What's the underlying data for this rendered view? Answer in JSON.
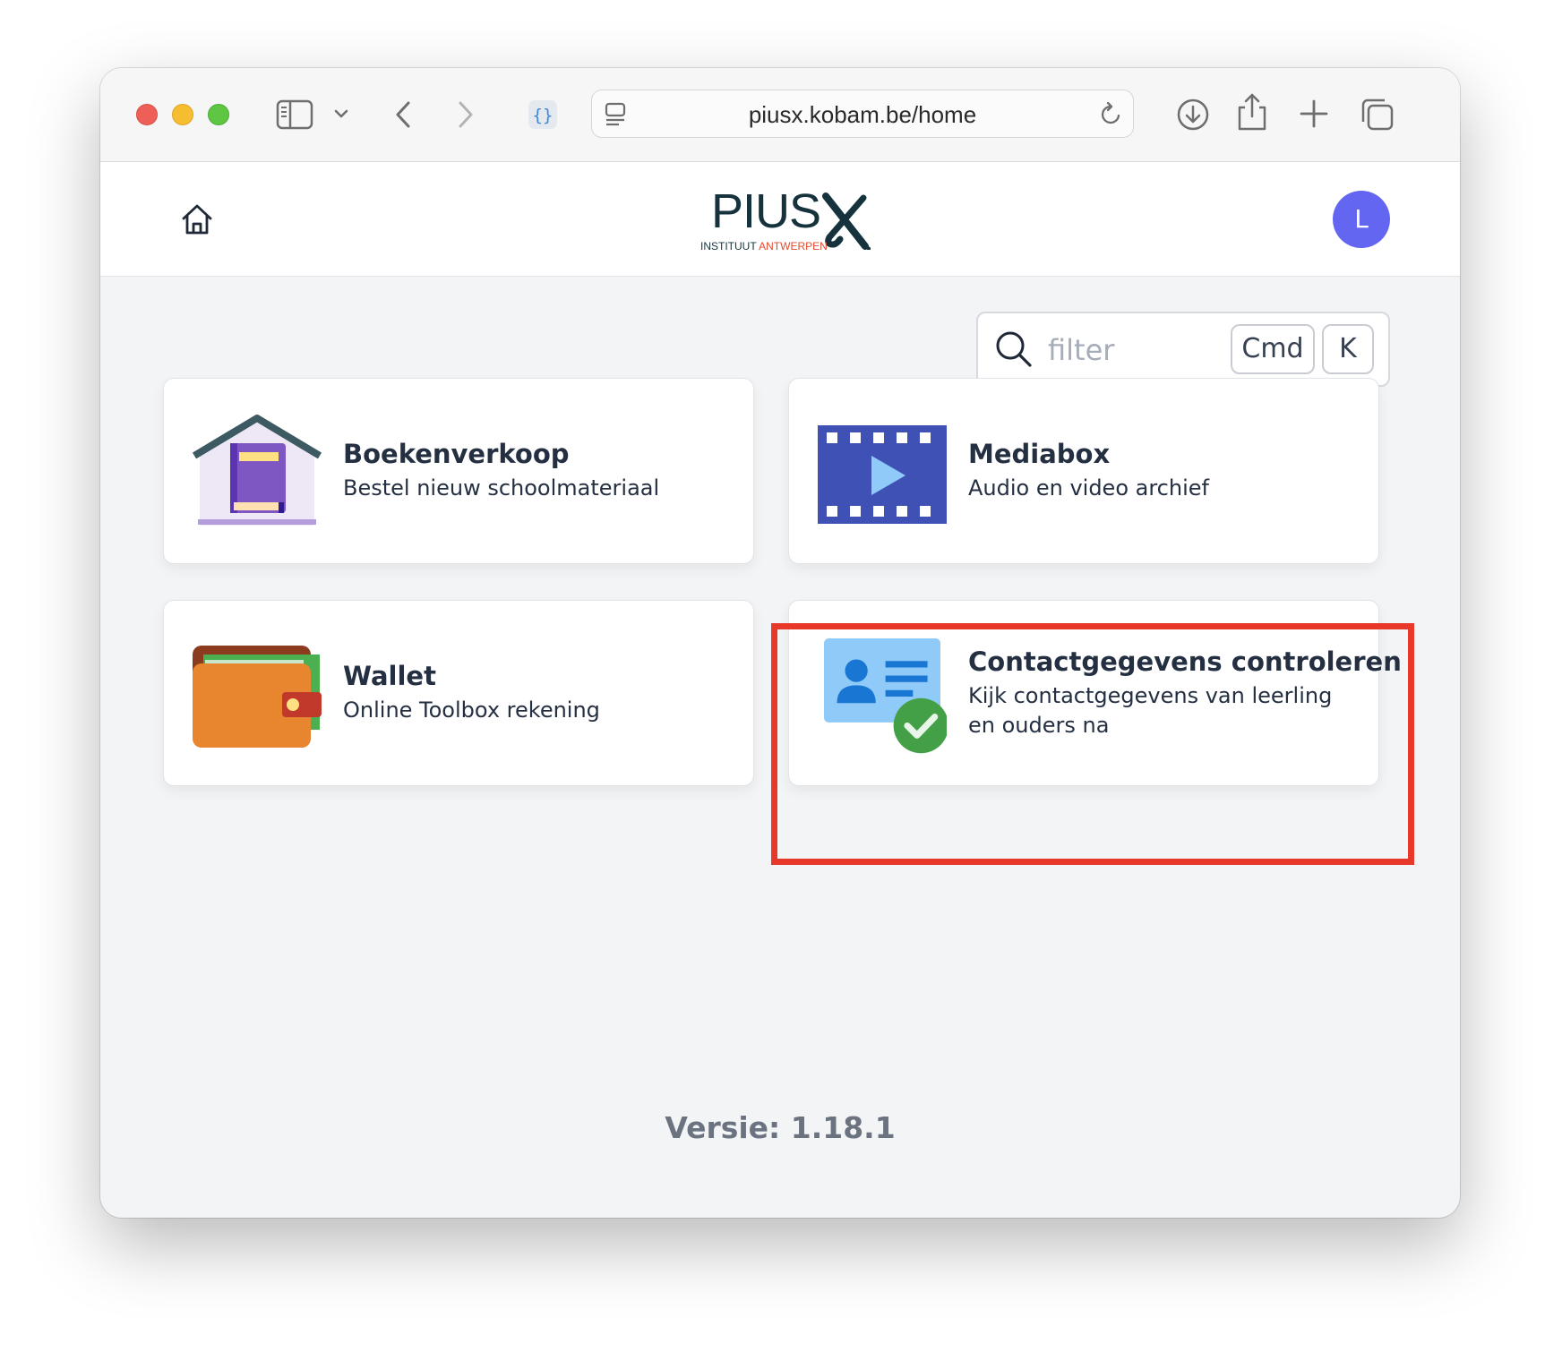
{
  "browser": {
    "url": "piusx.kobam.be/home",
    "icons": [
      "sidebar-icon",
      "chevron-down-icon",
      "back-icon",
      "forward-icon",
      "extension-icon",
      "page-icon",
      "reload-icon",
      "download-icon",
      "share-icon",
      "new-tab-icon",
      "tabs-overview-icon"
    ]
  },
  "header": {
    "logo_main": "PIUS",
    "logo_sub_1": "INSTITUUT ",
    "logo_sub_2": "ANTWERPEN",
    "avatar_initial": "L",
    "avatar_color": "#6366f1"
  },
  "search": {
    "placeholder": "filter",
    "shortcut_keys": [
      "Cmd",
      "K"
    ]
  },
  "cards": [
    {
      "title": "Boekenverkoop",
      "description": "Bestel nieuw schoolmateriaal",
      "icon": "book-house-icon"
    },
    {
      "title": "Mediabox",
      "description": "Audio en video archief",
      "icon": "film-play-icon"
    },
    {
      "title": "Wallet",
      "description": "Online Toolbox rekening",
      "icon": "wallet-icon"
    },
    {
      "title": "Contactgegevens controleren",
      "description": "Kijk contactgegevens van leerling en ouders na",
      "icon": "contact-card-check-icon",
      "highlighted": true
    }
  ],
  "footer": {
    "version": "Versie: 1.18.1"
  },
  "colors": {
    "highlight": "#e8382a",
    "background": "#f3f4f6"
  }
}
